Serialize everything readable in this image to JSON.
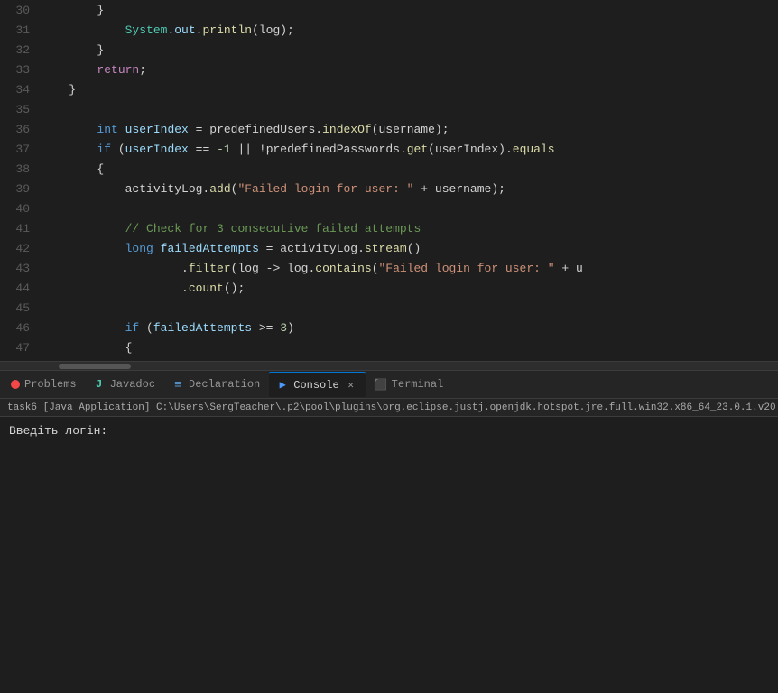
{
  "editor": {
    "lines": [
      {
        "num": "30",
        "content": "        }"
      },
      {
        "num": "31",
        "content": "            System.out.println(log);"
      },
      {
        "num": "32",
        "content": "        }"
      },
      {
        "num": "33",
        "content": "        return;"
      },
      {
        "num": "34",
        "content": "    }"
      },
      {
        "num": "35",
        "content": ""
      },
      {
        "num": "36",
        "content": "        int userIndex = predefinedUsers.indexOf(username);"
      },
      {
        "num": "37",
        "content": "        if (userIndex == -1 || !predefinedPasswords.get(userIndex).equals"
      },
      {
        "num": "38",
        "content": "        {"
      },
      {
        "num": "39",
        "content": "            activityLog.add(\"Failed login for user: \" + username);"
      },
      {
        "num": "40",
        "content": ""
      },
      {
        "num": "41",
        "content": "            // Check for 3 consecutive failed attempts"
      },
      {
        "num": "42",
        "content": "            long failedAttempts = activityLog.stream()"
      },
      {
        "num": "43",
        "content": "                    .filter(log -> log.contains(\"Failed login for user: \" + u"
      },
      {
        "num": "44",
        "content": "                    .count();"
      },
      {
        "num": "45",
        "content": ""
      },
      {
        "num": "46",
        "content": "            if (failedAttempts >= 3)"
      },
      {
        "num": "47",
        "content": "            {"
      }
    ]
  },
  "tabs": {
    "items": [
      {
        "id": "problems",
        "label": "Problems",
        "icon": "problems-icon",
        "active": false,
        "closeable": false
      },
      {
        "id": "javadoc",
        "label": "Javadoc",
        "icon": "javadoc-icon",
        "active": false,
        "closeable": false
      },
      {
        "id": "declaration",
        "label": "Declaration",
        "icon": "declaration-icon",
        "active": false,
        "closeable": false
      },
      {
        "id": "console",
        "label": "Console",
        "icon": "console-icon",
        "active": true,
        "closeable": true
      },
      {
        "id": "terminal",
        "label": "Terminal",
        "icon": "terminal-icon",
        "active": false,
        "closeable": false
      }
    ]
  },
  "path_bar": {
    "text": "task6 [Java Application] C:\\Users\\SergTeacher\\.p2\\pool\\plugins\\org.eclipse.justj.openjdk.hotspot.jre.full.win32.x86_64_23.0.1.v20"
  },
  "console": {
    "prompt_text": "Введіть логін:"
  }
}
